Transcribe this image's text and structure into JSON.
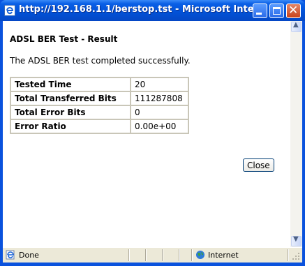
{
  "window": {
    "title": "http://192.168.1.1/berstop.tst - Microsoft Inte..."
  },
  "page": {
    "heading": "ADSL BER Test - Result",
    "message": "The ADSL BER test completed successfully.",
    "results": [
      {
        "label": "Tested Time",
        "value": "20"
      },
      {
        "label": "Total Transferred Bits",
        "value": "111287808"
      },
      {
        "label": "Total Error Bits",
        "value": "0"
      },
      {
        "label": "Error Ratio",
        "value": "0.00e+00"
      }
    ],
    "close_label": "Close"
  },
  "statusbar": {
    "status": "Done",
    "zone": "Internet"
  },
  "colors": {
    "titlebar": "#0252d8",
    "close_button": "#c9431c",
    "statusbar": "#ece9d8",
    "table_border": "#c9c6b8"
  },
  "icons": {
    "title": "ie-page-icon",
    "status": "ie-page-icon",
    "zone": "internet-globe-icon"
  }
}
